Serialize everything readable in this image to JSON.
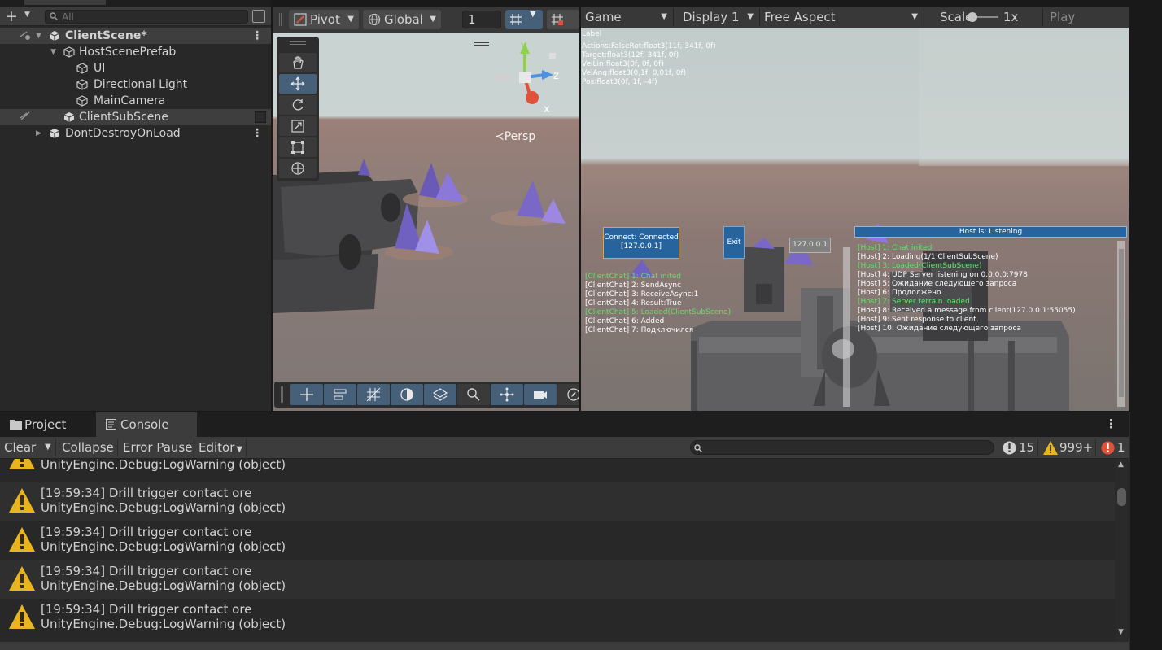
{
  "hierarchy": {
    "search_placeholder": "All",
    "rows": [
      {
        "label": "ClientScene*"
      },
      {
        "label": "HostScenePrefab"
      },
      {
        "label": "UI"
      },
      {
        "label": "Directional Light"
      },
      {
        "label": "MainCamera"
      },
      {
        "label": "ClientSubScene"
      },
      {
        "label": "DontDestroyOnLoad"
      }
    ]
  },
  "scene": {
    "pivot_label": "Pivot",
    "global_label": "Global",
    "grid_snap_value": "1",
    "persp_label": "≺Persp",
    "gizmo_axes": {
      "y": "y",
      "z": "z",
      "x": "x"
    },
    "icons": [
      "hand-icon",
      "move-icon",
      "rotate-icon",
      "scale-icon",
      "rect-icon",
      "transform-icon"
    ]
  },
  "game": {
    "tab_label": "Game",
    "display_label": "Display 1",
    "aspect_label": "Free Aspect",
    "scale_label": "Scale",
    "scale_value": "1x",
    "play_focused_label": "Play Focused",
    "overlay": {
      "label_text": "Label",
      "debug_lines": [
        "Actions:FalseRot:float3(11f, 341f, 0f)",
        "Target:float3(12f, 341f, 0f)",
        "VelLin:float3(0f, 0f, 0f)",
        "VelAng:float3(0,1f, 0,01f, 0f)",
        "Pos:float3(0f, 1f, -4f)"
      ],
      "connect_line1": "Connect: Connected",
      "connect_line2": "[127.0.0.1]",
      "exit_label": "Exit",
      "ip_value": "127.0.0.1",
      "host_status": "Host is: Listening",
      "client_chat": [
        {
          "text": "[ClientChat] 1: Chat inited",
          "color": "#5fe36a"
        },
        {
          "text": "[ClientChat] 2: SendAsync",
          "color": "#ffffff"
        },
        {
          "text": "[ClientChat] 3: ReceiveAsync:1",
          "color": "#ffffff"
        },
        {
          "text": "[ClientChat] 4: Result:True",
          "color": "#ffffff"
        },
        {
          "text": "[ClientChat] 5: Loaded(ClientSubScene)",
          "color": "#5fe36a"
        },
        {
          "text": "[ClientChat] 6: Added",
          "color": "#ffffff"
        },
        {
          "text": "[ClientChat] 7: Подключился",
          "color": "#ffffff"
        }
      ],
      "host_chat": [
        {
          "text": "[Host] 1: Chat inited",
          "color": "#5fe36a"
        },
        {
          "text": "[Host] 2: Loading(1/1 ClientSubScene)",
          "color": "#ffffff"
        },
        {
          "text": "[Host] 3: Loaded(ClientSubScene)",
          "color": "#5fe36a"
        },
        {
          "text": "[Host] 4: UDP Server listening on 0.0.0.0:7978",
          "color": "#ffffff"
        },
        {
          "text": "[Host] 5: Ожидание следующего запроса",
          "color": "#ffffff"
        },
        {
          "text": "[Host] 6: Продолжено",
          "color": "#ffffff"
        },
        {
          "text": "[Host] 7: Server terrain loaded",
          "color": "#5fe36a"
        },
        {
          "text": "[Host] 8: Received a message from client(127.0.0.1:55055)",
          "color": "#ffffff"
        },
        {
          "text": "[Host] 9: Sent response to client.",
          "color": "#ffffff"
        },
        {
          "text": "[Host] 10: Ожидание следующего запроса",
          "color": "#ffffff"
        }
      ]
    }
  },
  "console": {
    "tabs": [
      {
        "label": "Project"
      },
      {
        "label": "Console"
      }
    ],
    "toolbar": {
      "clear_label": "Clear",
      "collapse_label": "Collapse",
      "error_pause_label": "Error Pause",
      "editor_label": "Editor",
      "info_count": "15",
      "warning_count": "999+",
      "error_count": "1"
    },
    "entries": [
      {
        "line1": "",
        "line2": "UnityEngine.Debug:LogWarning (object)"
      },
      {
        "line1": "[19:59:34] Drill trigger contact ore",
        "line2": "UnityEngine.Debug:LogWarning (object)"
      },
      {
        "line1": "[19:59:34] Drill trigger contact ore",
        "line2": "UnityEngine.Debug:LogWarning (object)"
      },
      {
        "line1": "[19:59:34] Drill trigger contact ore",
        "line2": "UnityEngine.Debug:LogWarning (object)"
      },
      {
        "line1": "[19:59:34] Drill trigger contact ore",
        "line2": "UnityEngine.Debug:LogWarning (object)"
      }
    ]
  },
  "colors": {
    "accent_blue": "#46607a",
    "ui_button_blue": "#27639c",
    "chat_green": "#5fe36a",
    "warning_yellow": "#e8b520",
    "error_red": "#e0533a"
  }
}
